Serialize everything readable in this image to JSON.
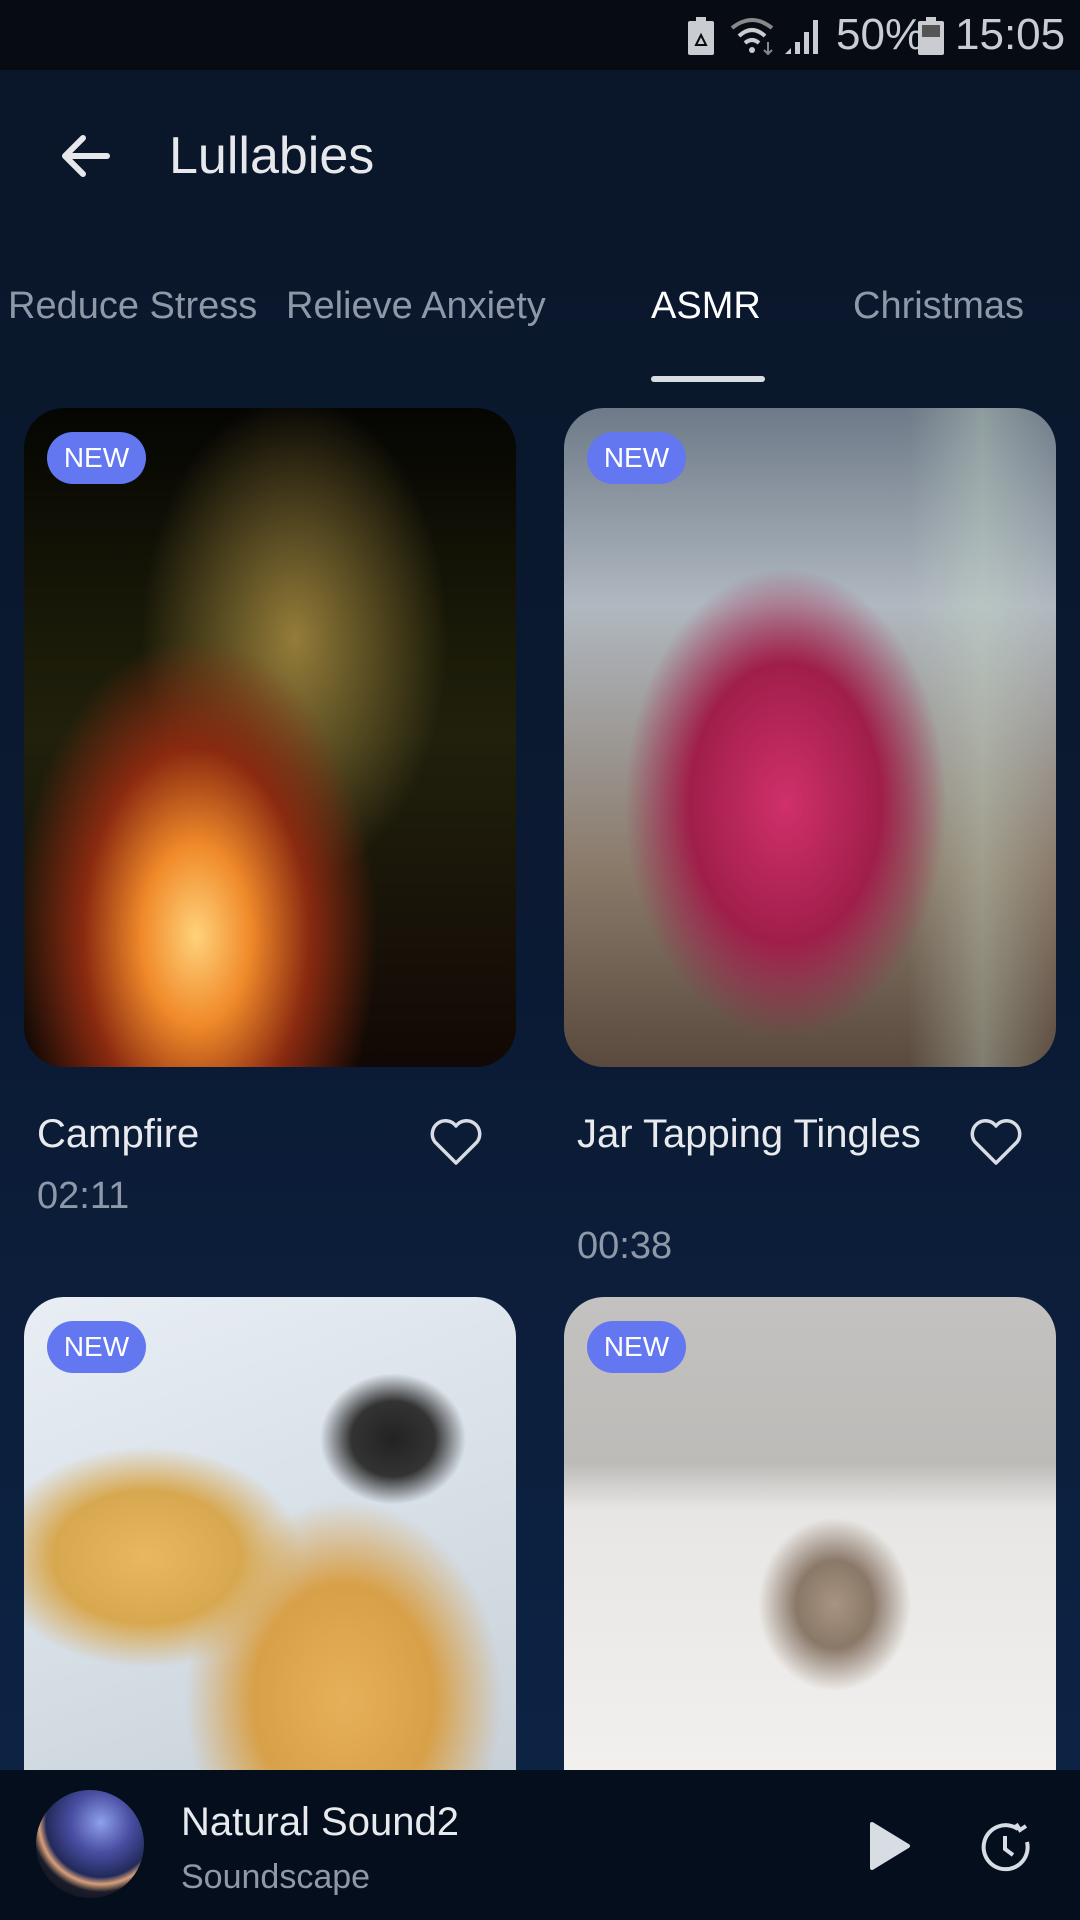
{
  "status_bar": {
    "battery_percent": "50%",
    "time": "15:05",
    "icons": [
      "battery-saver-icon",
      "wifi-icon",
      "signal-icon",
      "battery-icon"
    ]
  },
  "header": {
    "title": "Lullabies",
    "back_icon": "arrow-left-icon"
  },
  "tabs": [
    {
      "label": "Reduce Stress"
    },
    {
      "label": "Relieve Anxiety"
    },
    {
      "label": "ASMR",
      "active": true
    },
    {
      "label": "Christmas"
    }
  ],
  "cards": [
    {
      "badge": "NEW",
      "title": "Campfire",
      "duration": "02:11"
    },
    {
      "badge": "NEW",
      "title": "Jar Tapping Tingles",
      "duration": "00:38"
    },
    {
      "badge": "NEW"
    },
    {
      "badge": "NEW"
    }
  ],
  "player": {
    "title": "Natural Sound2",
    "subtitle": "Soundscape"
  },
  "colors": {
    "badge": "#6378f0",
    "background": "#0b1a33",
    "player": "#040e1c"
  }
}
